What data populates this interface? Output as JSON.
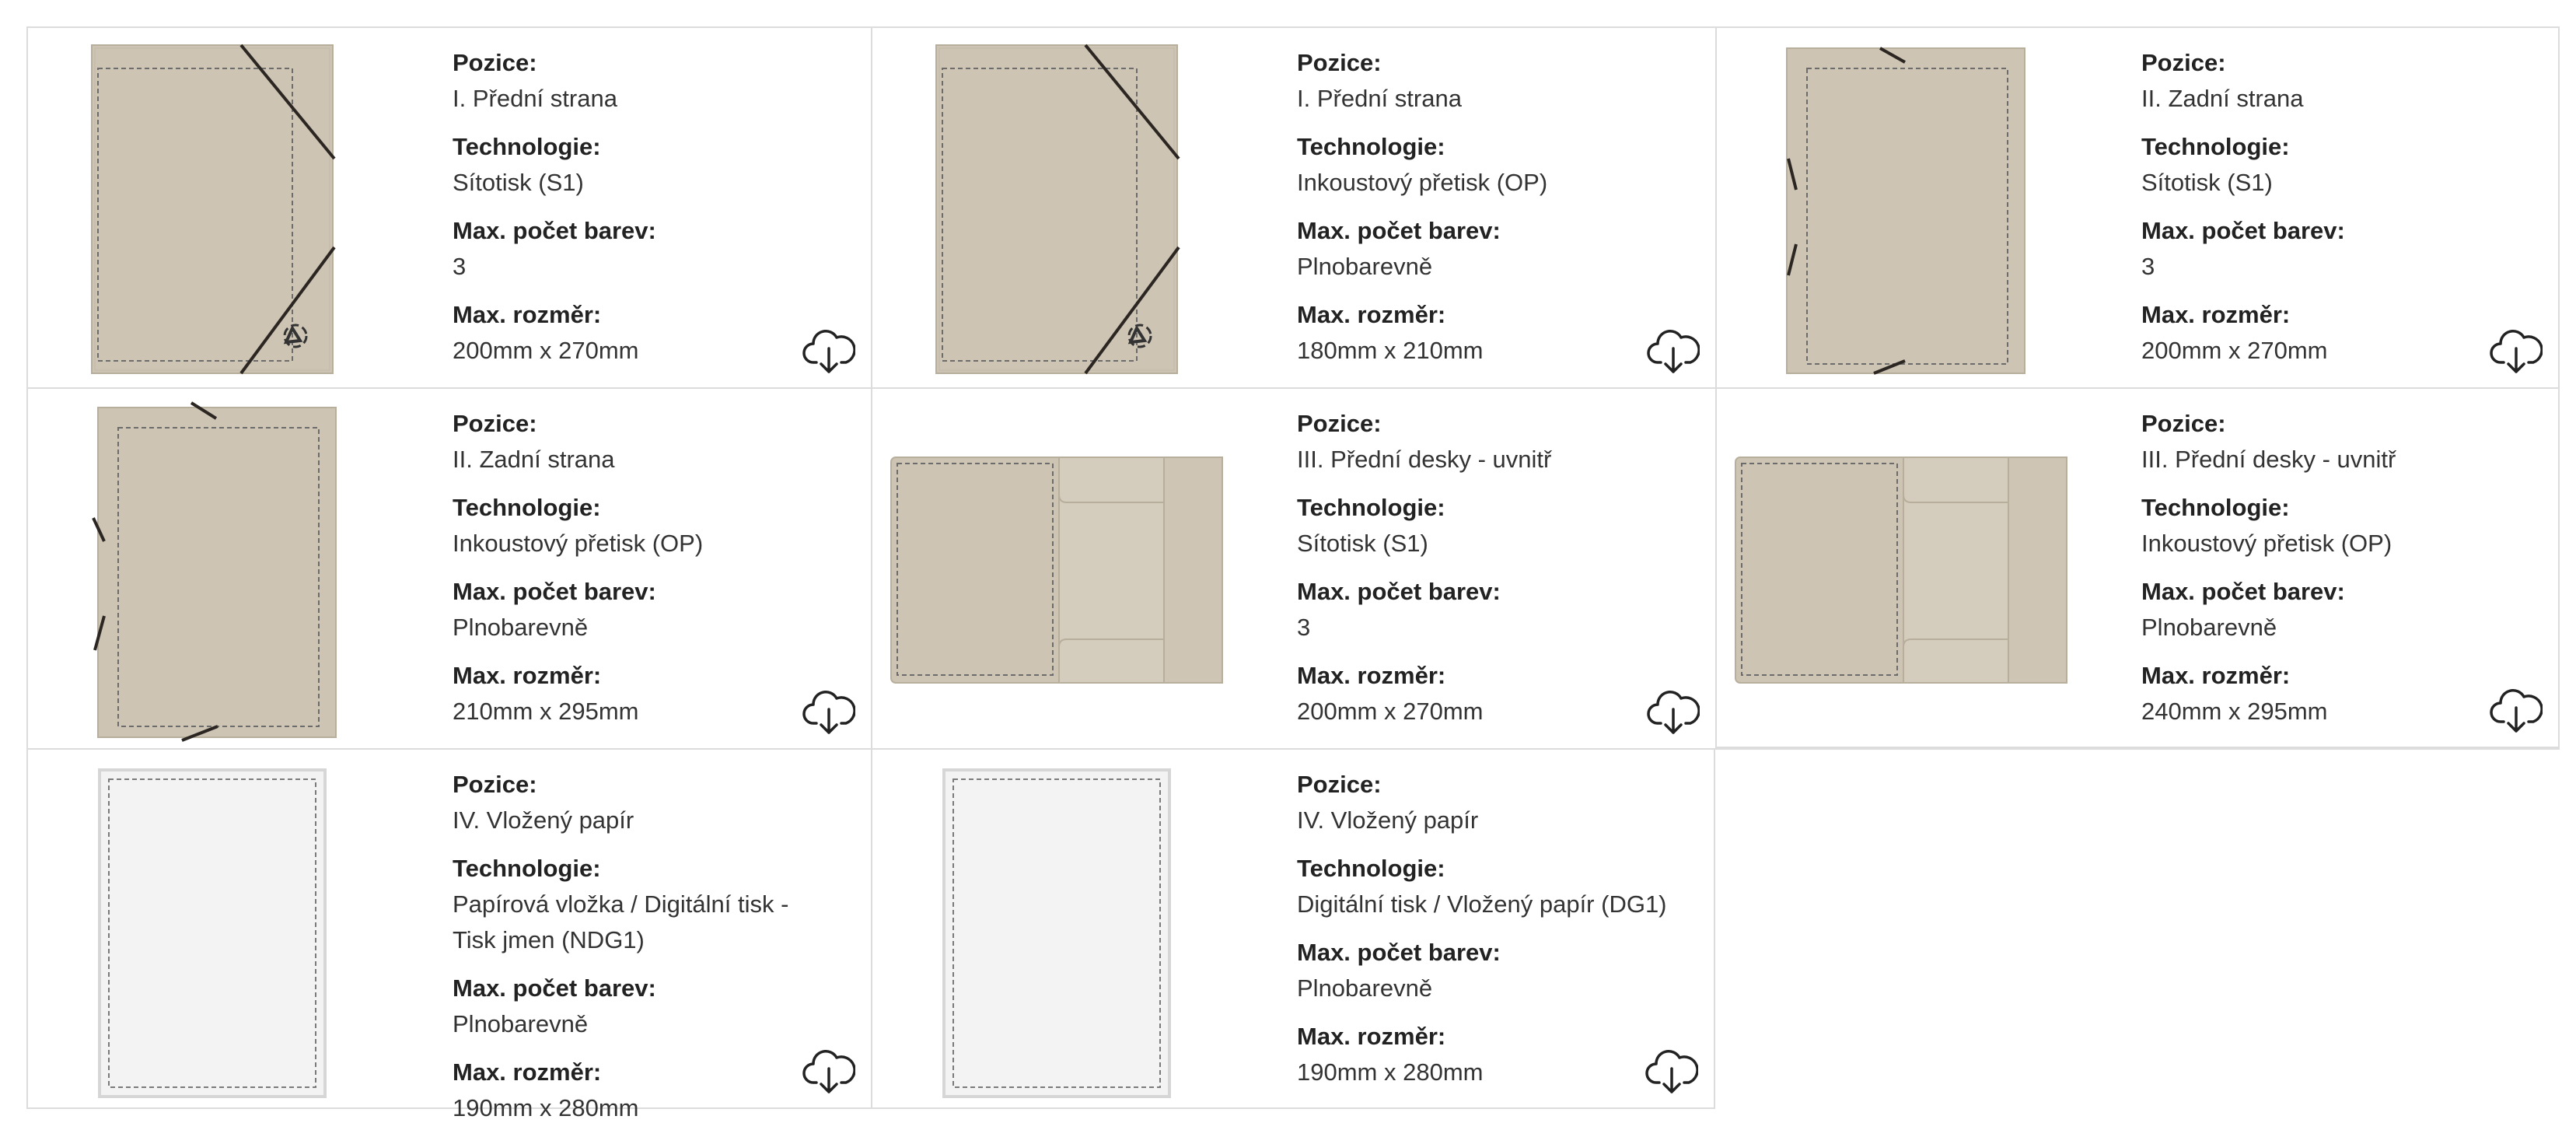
{
  "labels": {
    "pozice": "Pozice:",
    "technologie": "Technologie:",
    "barvy": "Max. počet barev:",
    "rozmer": "Max. rozměr:"
  },
  "items": [
    {
      "pozice": "I. Přední strana",
      "technologie": "Sítotisk (S1)",
      "barvy": "3",
      "rozmer": "200mm x 270mm",
      "image": "folder-front"
    },
    {
      "pozice": "I. Přední strana",
      "technologie": "Inkoustový přetisk (OP)",
      "barvy": "Plnobarevně",
      "rozmer": "180mm x 210mm",
      "image": "folder-front"
    },
    {
      "pozice": "II. Zadní strana",
      "technologie": "Sítotisk (S1)",
      "barvy": "3",
      "rozmer": "200mm x 270mm",
      "image": "folder-back"
    },
    {
      "pozice": "II. Zadní strana",
      "technologie": "Inkoustový přetisk (OP)",
      "barvy": "Plnobarevně",
      "rozmer": "210mm x 295mm",
      "image": "folder-back"
    },
    {
      "pozice": "III. Přední desky - uvnitř",
      "technologie": "Sítotisk (S1)",
      "barvy": "3",
      "rozmer": "200mm x 270mm",
      "image": "folder-open"
    },
    {
      "pozice": "III. Přední desky - uvnitř",
      "technologie": "Inkoustový přetisk (OP)",
      "barvy": "Plnobarevně",
      "rozmer": "240mm x 295mm",
      "image": "folder-open"
    },
    {
      "pozice": "IV. Vložený papír",
      "technologie": "Papírová vložka / Digitální tisk - Tisk jmen (NDG1)",
      "barvy": "Plnobarevně",
      "rozmer": "190mm x 280mm",
      "image": "paper-insert"
    },
    {
      "pozice": "IV. Vložený papír",
      "technologie": "Digitální tisk / Vložený papír (DG1)",
      "barvy": "Plnobarevně",
      "rozmer": "190mm x 280mm",
      "image": "paper-insert"
    }
  ],
  "icons": {
    "download": "cloud-download-icon",
    "recycle": "recycle-icon"
  },
  "colors": {
    "kraft": "#cdc4b4",
    "kraft_edge": "#b8ae9c",
    "paper": "#f3f3f3",
    "border": "#dcdcdc",
    "elastic": "#2b2622"
  }
}
